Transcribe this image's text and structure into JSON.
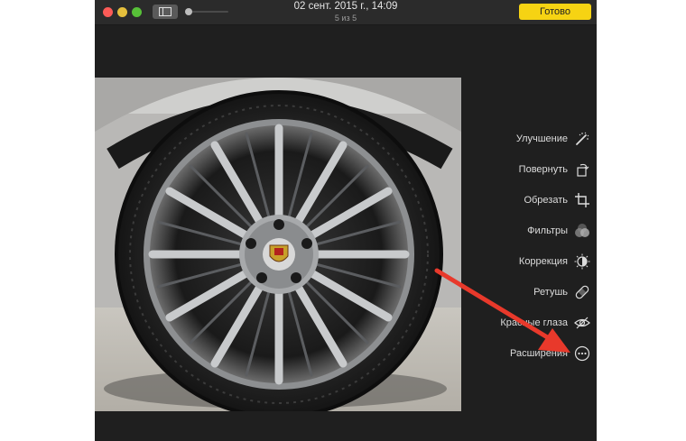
{
  "window": {
    "title": "02 сент. 2015 г., 14:09",
    "subtitle": "5 из 5",
    "done_label": "Готово"
  },
  "tools": [
    {
      "label": "Улучшение",
      "icon": "magic-wand-icon"
    },
    {
      "label": "Повернуть",
      "icon": "rotate-icon"
    },
    {
      "label": "Обрезать",
      "icon": "crop-icon"
    },
    {
      "label": "Фильтры",
      "icon": "filters-icon"
    },
    {
      "label": "Коррекция",
      "icon": "adjust-icon"
    },
    {
      "label": "Ретушь",
      "icon": "bandage-icon"
    },
    {
      "label": "Красные глаза",
      "icon": "red-eye-icon"
    },
    {
      "label": "Расширения",
      "icon": "more-icon"
    }
  ],
  "colors": {
    "window_bg": "#1f1f1f",
    "done_button": "#f6d313",
    "annotation_arrow": "#e8392b"
  }
}
